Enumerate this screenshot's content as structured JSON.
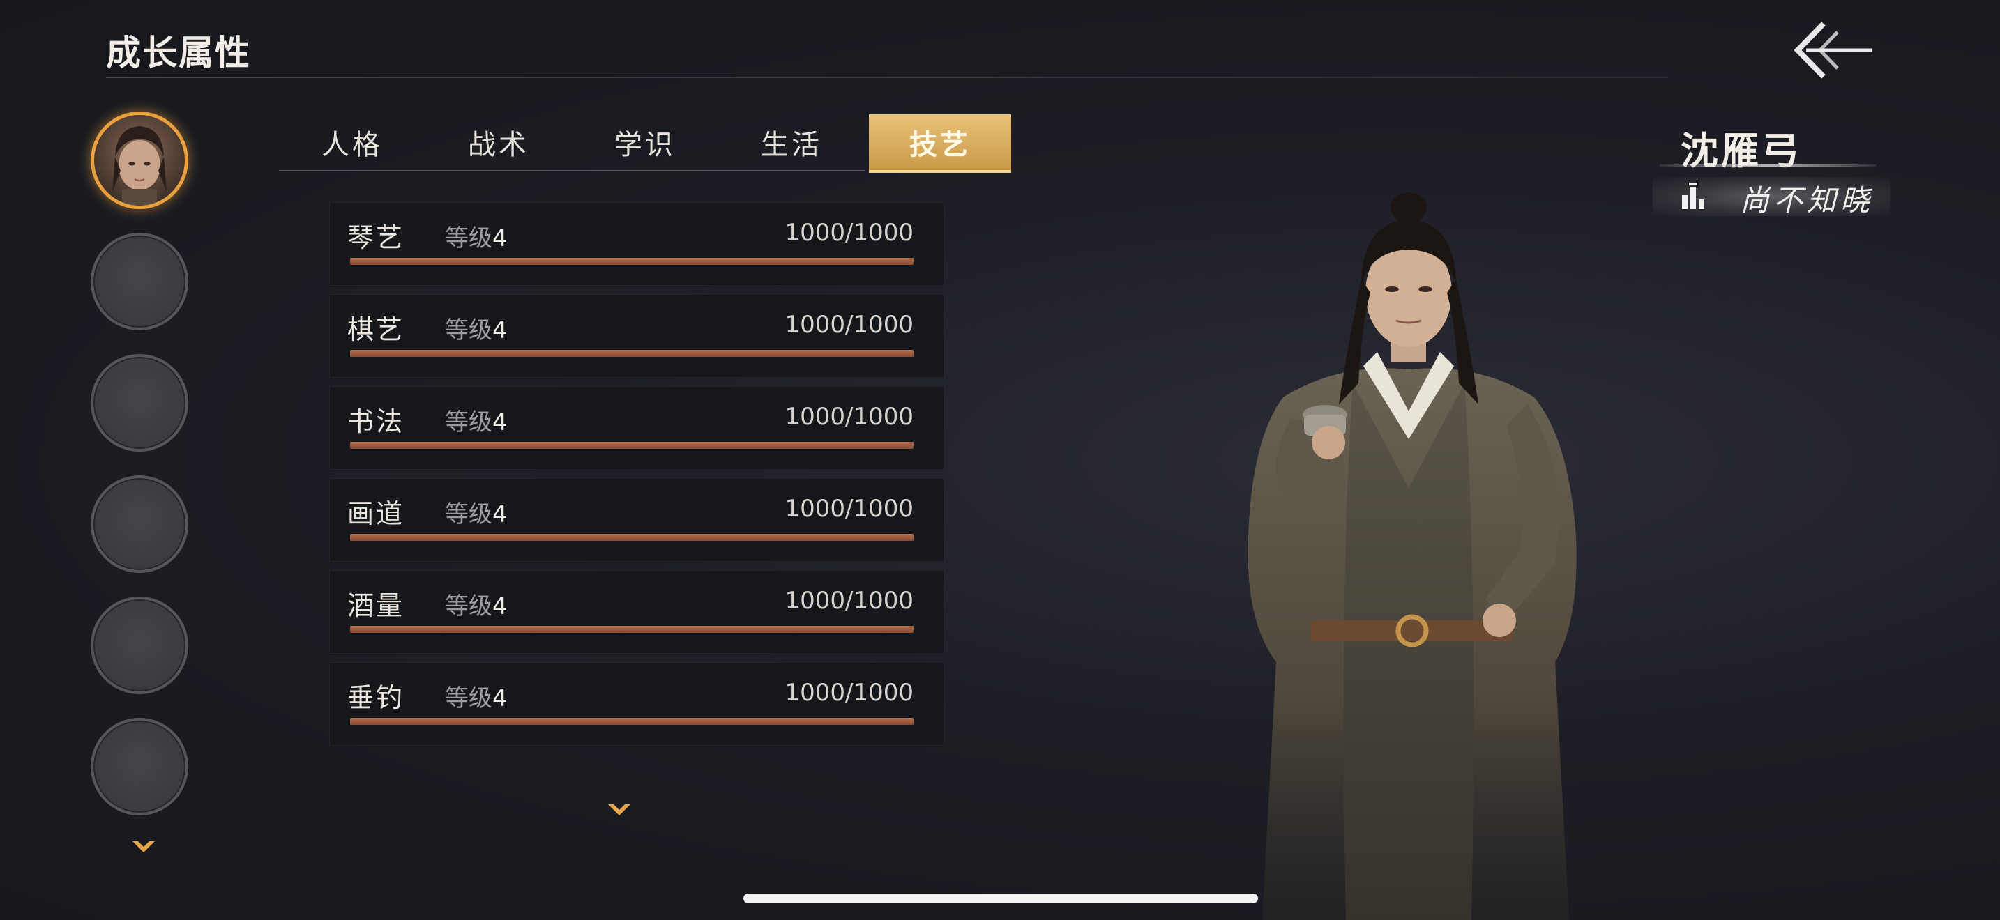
{
  "header": {
    "title": "成长属性",
    "back_icon": "back-arrow-icon"
  },
  "avatars": {
    "count": 6,
    "active_index": 0
  },
  "tabs": [
    {
      "label": "人格",
      "active": false
    },
    {
      "label": "战术",
      "active": false
    },
    {
      "label": "学识",
      "active": false
    },
    {
      "label": "生活",
      "active": false
    },
    {
      "label": "技艺",
      "active": true
    }
  ],
  "skills": [
    {
      "name": "琴艺",
      "level_label": "等级",
      "level": "4",
      "progress_text": "1000/1000",
      "progress": 1.0
    },
    {
      "name": "棋艺",
      "level_label": "等级",
      "level": "4",
      "progress_text": "1000/1000",
      "progress": 1.0
    },
    {
      "name": "书法",
      "level_label": "等级",
      "level": "4",
      "progress_text": "1000/1000",
      "progress": 1.0
    },
    {
      "name": "画道",
      "level_label": "等级",
      "level": "4",
      "progress_text": "1000/1000",
      "progress": 1.0
    },
    {
      "name": "酒量",
      "level_label": "等级",
      "level": "4",
      "progress_text": "1000/1000",
      "progress": 1.0
    },
    {
      "name": "垂钓",
      "level_label": "等级",
      "level": "4",
      "progress_text": "1000/1000",
      "progress": 1.0
    }
  ],
  "character": {
    "name": "沈雁弓",
    "title": "尚不知晓"
  },
  "colors": {
    "accent_gold": "#e9c37a",
    "avatar_ring": "#e8a03e",
    "bar_fill": "#b46d4c",
    "background": "#1d1e25"
  }
}
